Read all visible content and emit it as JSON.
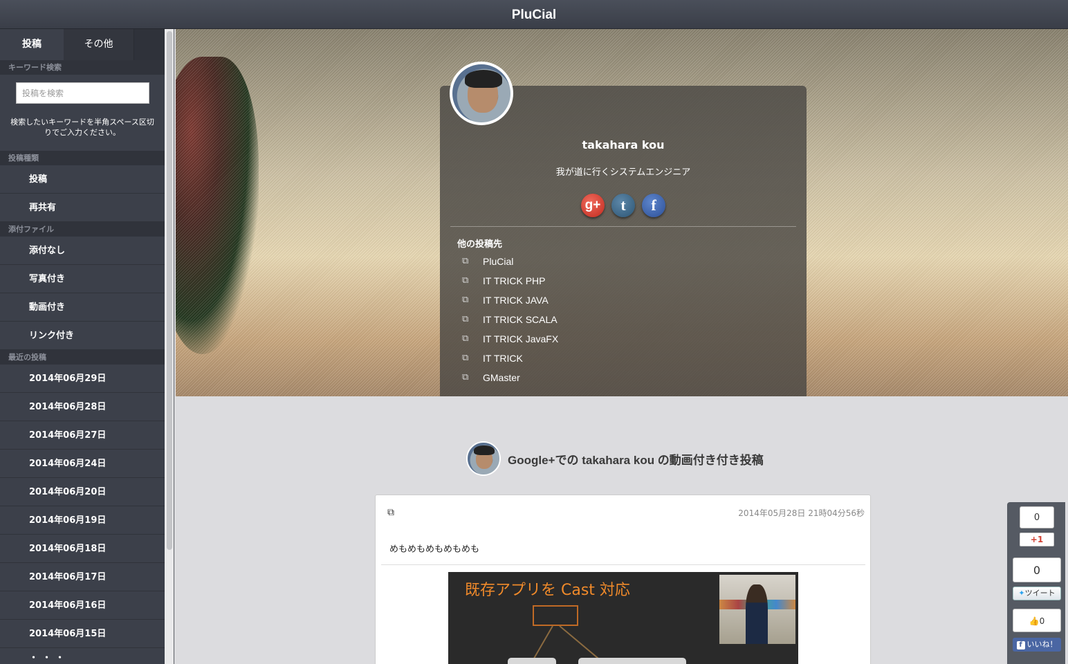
{
  "app": {
    "title": "PluCial"
  },
  "sidebar": {
    "tabs": [
      {
        "label": "投稿"
      },
      {
        "label": "その他"
      }
    ],
    "keyword_section": "キーワード検索",
    "search": {
      "placeholder": "投稿を検索",
      "value": ""
    },
    "search_help": "検索したいキーワードを半角スペース区切りでご入力ください。",
    "type_section": "投稿種類",
    "type_items": [
      "投稿",
      "再共有"
    ],
    "attach_section": "添付ファイル",
    "attach_items": [
      "添付なし",
      "写真付き",
      "動画付き",
      "リンク付き"
    ],
    "recent_section": "最近の投稿",
    "recent_items": [
      "2014年06月29日",
      "2014年06月28日",
      "2014年06月27日",
      "2014年06月24日",
      "2014年06月20日",
      "2014年06月19日",
      "2014年06月18日",
      "2014年06月17日",
      "2014年06月16日",
      "2014年06月15日"
    ],
    "more": "・・・"
  },
  "profile": {
    "name": "takahara kou",
    "tagline": "我が道に行くシステムエンジニア",
    "socials": [
      {
        "icon": "google-plus-icon",
        "glyph": "g+"
      },
      {
        "icon": "tumblr-icon",
        "glyph": "t"
      },
      {
        "icon": "facebook-icon",
        "glyph": "f"
      }
    ],
    "links_title": "他の投稿先",
    "links": [
      "PluCial",
      "IT TRICK PHP",
      "IT TRICK JAVA",
      "IT TRICK SCALA",
      "IT TRICK JavaFX",
      "IT TRICK",
      "GMaster"
    ]
  },
  "post": {
    "heading": "Google+での takahara kou の動画付き付き投稿",
    "date": "2014年05月28日 21時04分56秒",
    "body": "めもめもめもめもめも",
    "video_title": "既存アプリを Cast 対応"
  },
  "share": {
    "gplus_count": "0",
    "gplus_label": "+1",
    "tweet_count": "0",
    "tweet_label": "ツイート",
    "like_count": "0",
    "like_label": "いいね！"
  }
}
